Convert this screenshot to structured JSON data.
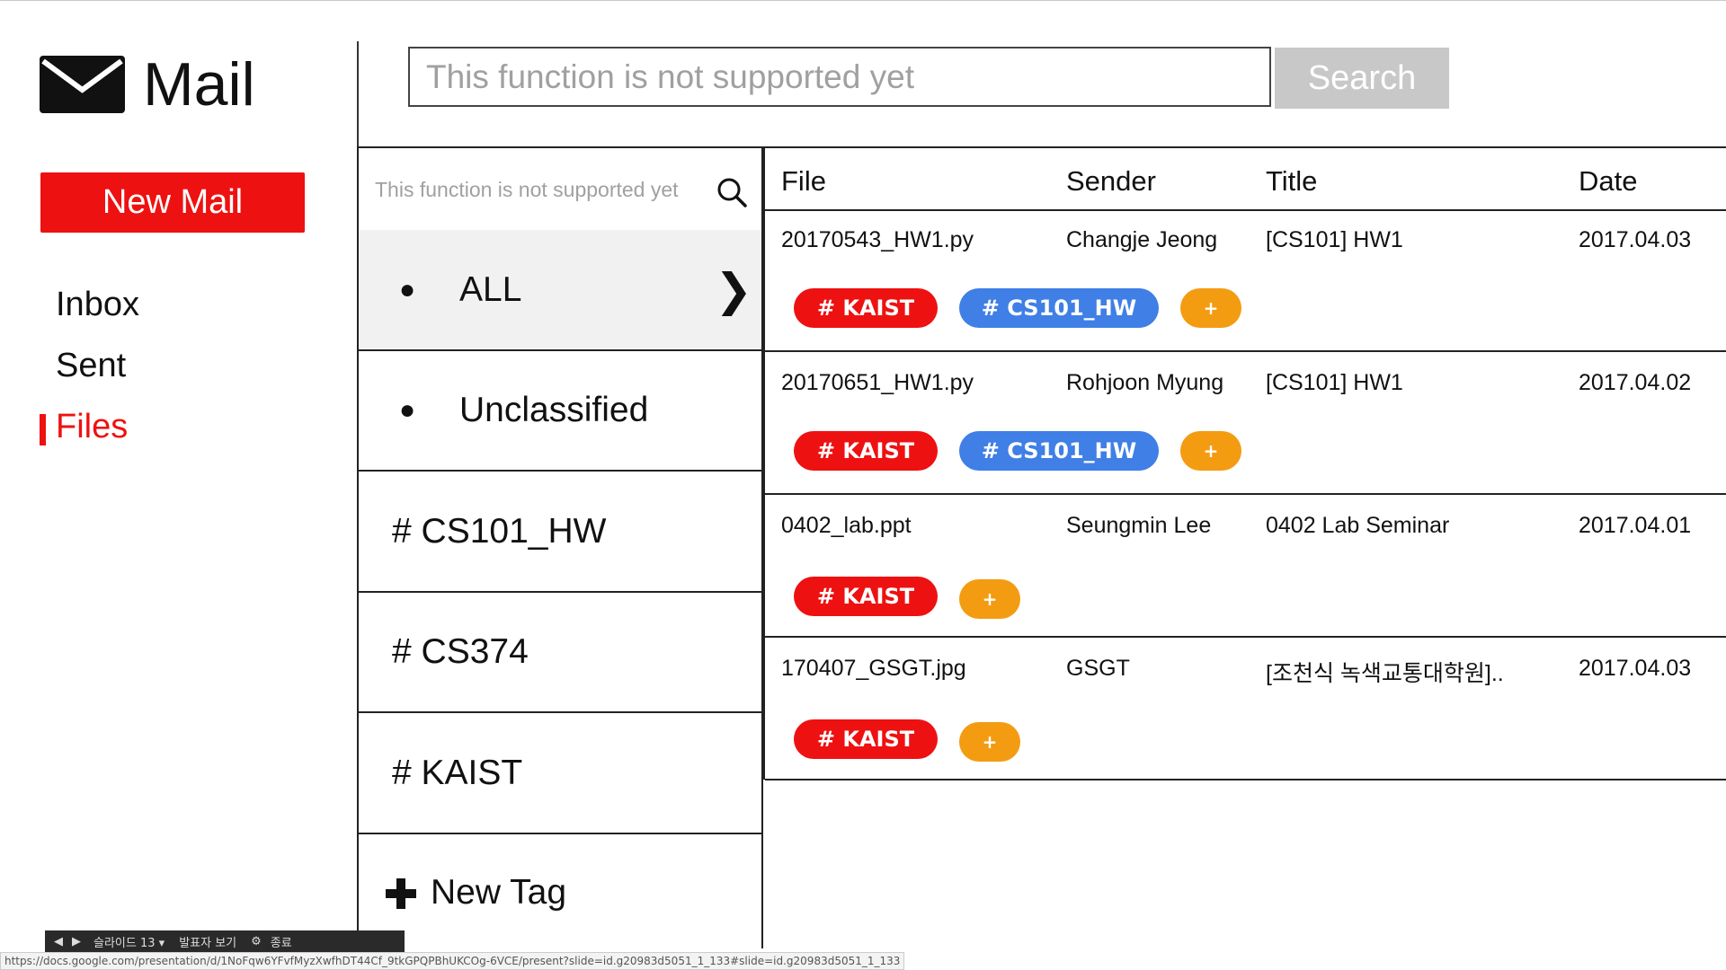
{
  "app": {
    "title": "Mail"
  },
  "sidebar": {
    "new_mail_label": "New Mail",
    "items": [
      {
        "label": "Inbox",
        "active": false
      },
      {
        "label": "Sent",
        "active": false
      },
      {
        "label": "Files",
        "active": true
      }
    ]
  },
  "search": {
    "placeholder": "This function is not supported yet",
    "button_label": "Search"
  },
  "tag_panel": {
    "search_placeholder": "This function is not supported yet",
    "tags": [
      {
        "label": "ALL",
        "bullet": "●",
        "selected": true,
        "chevron": "❯"
      },
      {
        "label": "Unclassified",
        "bullet": "●"
      },
      {
        "label": "# CS101_HW"
      },
      {
        "label": "# CS374"
      },
      {
        "label": "# KAIST"
      }
    ],
    "new_tag_label": "New Tag"
  },
  "file_table": {
    "headers": {
      "file": "File",
      "sender": "Sender",
      "title": "Title",
      "date": "Date"
    },
    "rows": [
      {
        "file": "20170543_HW1.py",
        "sender": "Changje Jeong",
        "title": "[CS101] HW1",
        "date": "2017.04.03",
        "tags": [
          "# KAIST",
          "# CS101_HW"
        ],
        "add": "+"
      },
      {
        "file": "20170651_HW1.py",
        "sender": "Rohjoon Myung",
        "title": "[CS101] HW1",
        "date": "2017.04.02",
        "tags": [
          "# KAIST",
          "# CS101_HW"
        ],
        "add": "+"
      },
      {
        "file": "0402_lab.ppt",
        "sender": "Seungmin Lee",
        "title": "0402 Lab Seminar",
        "date": "2017.04.01",
        "tags": [
          "# KAIST"
        ],
        "add": "+"
      },
      {
        "file": "170407_GSGT.jpg",
        "sender": "GSGT",
        "title": "[조천식 녹색교통대학원]..",
        "date": "2017.04.03",
        "tags": [
          "# KAIST"
        ],
        "add": "+"
      }
    ]
  },
  "presenter_bar": {
    "slide_label": "슬라이드 13 ▾",
    "speaker_notes": "발표자 보기",
    "end_label": "종료"
  },
  "status_url": "https://docs.google.com/presentation/d/1NoFqw6YFvfMyzXwfhDT44Cf_9tkGPQPBhUKCOg-6VCE/present?slide=id.g20983d5051_1_133#slide=id.g20983d5051_1_133",
  "colors": {
    "accent_red": "#ee1111",
    "tag_blue": "#3f7fe6",
    "tag_orange": "#f39c12",
    "search_button": "#c8c8c8"
  },
  "icons": {
    "logo": "envelope-icon",
    "tag_search": "search-icon",
    "new_tag": "plus-icon",
    "selected_tag": "chevron-right-icon"
  }
}
